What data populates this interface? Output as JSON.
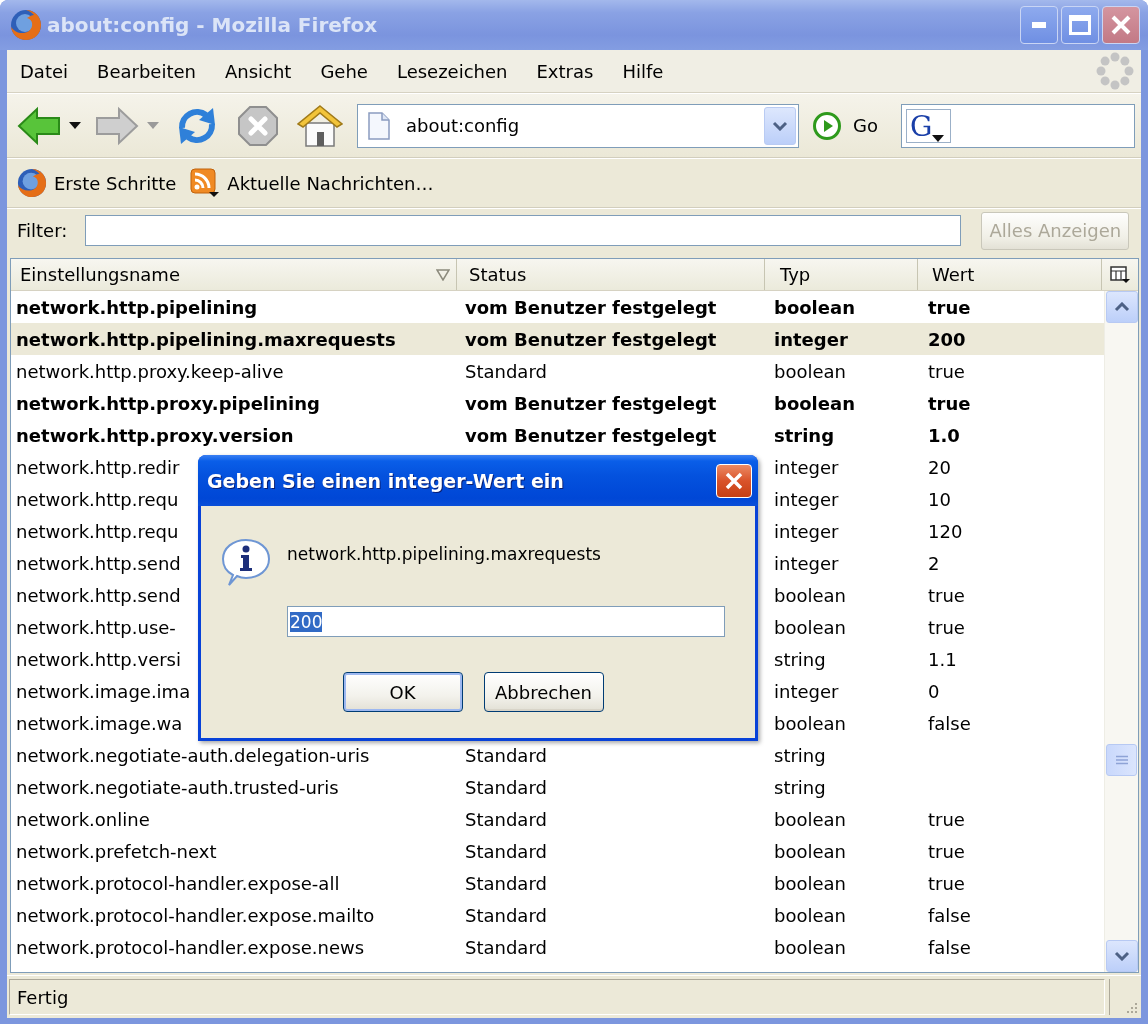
{
  "window": {
    "title": "about:config - Mozilla Firefox",
    "active": false
  },
  "menu": [
    {
      "label": "Datei"
    },
    {
      "label": "Bearbeiten"
    },
    {
      "label": "Ansicht"
    },
    {
      "label": "Gehe"
    },
    {
      "label": "Lesezeichen"
    },
    {
      "label": "Extras"
    },
    {
      "label": "Hilfe"
    }
  ],
  "navigation": {
    "buttons": [
      {
        "kind": "back",
        "disabled": false,
        "menu": true
      },
      {
        "kind": "forward",
        "disabled": true,
        "menu": true
      },
      {
        "kind": "reload",
        "disabled": false,
        "menu": false
      },
      {
        "kind": "stop",
        "disabled": true,
        "menu": false
      },
      {
        "kind": "home",
        "disabled": false,
        "menu": false
      }
    ],
    "url": "about:config",
    "go_label": "Go",
    "search_engine": "G"
  },
  "bookmarks": [
    {
      "kind": "page",
      "label": "Erste Schritte"
    },
    {
      "kind": "feed",
      "label": "Aktuelle Nachrichten…"
    }
  ],
  "filter": {
    "label": "Filter:",
    "button": {
      "label": "Alles Anzeigen",
      "disabled": true
    }
  },
  "table": {
    "columns": [
      {
        "label": "Einstellungsname",
        "sorted": true
      },
      {
        "label": "Status",
        "sorted": false
      },
      {
        "label": "Typ",
        "sorted": false
      },
      {
        "label": "Wert",
        "sorted": false
      }
    ],
    "rows": [
      {
        "name": "network.http.pipelining",
        "status": "vom Benutzer festgelegt",
        "type": "boolean",
        "value": "true",
        "modified": true,
        "selected": false
      },
      {
        "name": "network.http.pipelining.maxrequests",
        "status": "vom Benutzer festgelegt",
        "type": "integer",
        "value": "200",
        "modified": true,
        "selected": true
      },
      {
        "name": "network.http.proxy.keep-alive",
        "status": "Standard",
        "type": "boolean",
        "value": "true",
        "modified": false,
        "selected": false
      },
      {
        "name": "network.http.proxy.pipelining",
        "status": "vom Benutzer festgelegt",
        "type": "boolean",
        "value": "true",
        "modified": true,
        "selected": false
      },
      {
        "name": "network.http.proxy.version",
        "status": "vom Benutzer festgelegt",
        "type": "string",
        "value": "1.0",
        "modified": true,
        "selected": false
      },
      {
        "name": "network.http.redir",
        "type": "integer",
        "value": "20",
        "modified": false,
        "selected": false
      },
      {
        "name": "network.http.requ",
        "type": "integer",
        "value": "10",
        "modified": false,
        "selected": false
      },
      {
        "name": "network.http.requ",
        "type": "integer",
        "value": "120",
        "modified": false,
        "selected": false
      },
      {
        "name": "network.http.send",
        "type": "integer",
        "value": "2",
        "modified": false,
        "selected": false
      },
      {
        "name": "network.http.send",
        "type": "boolean",
        "value": "true",
        "modified": false,
        "selected": false
      },
      {
        "name": "network.http.use-",
        "type": "boolean",
        "value": "true",
        "modified": false,
        "selected": false
      },
      {
        "name": "network.http.versi",
        "type": "string",
        "value": "1.1",
        "modified": false,
        "selected": false
      },
      {
        "name": "network.image.ima",
        "type": "integer",
        "value": "0",
        "modified": false,
        "selected": false
      },
      {
        "name": "network.image.wa",
        "type": "boolean",
        "value": "false",
        "modified": false,
        "selected": false
      },
      {
        "name": "network.negotiate-auth.delegation-uris",
        "status": "Standard",
        "type": "string",
        "modified": false,
        "selected": false
      },
      {
        "name": "network.negotiate-auth.trusted-uris",
        "status": "Standard",
        "type": "string",
        "modified": false,
        "selected": false
      },
      {
        "name": "network.online",
        "status": "Standard",
        "type": "boolean",
        "value": "true",
        "modified": false,
        "selected": false
      },
      {
        "name": "network.prefetch-next",
        "status": "Standard",
        "type": "boolean",
        "value": "true",
        "modified": false,
        "selected": false
      },
      {
        "name": "network.protocol-handler.expose-all",
        "status": "Standard",
        "type": "boolean",
        "value": "true",
        "modified": false,
        "selected": false
      },
      {
        "name": "network.protocol-handler.expose.mailto",
        "status": "Standard",
        "type": "boolean",
        "value": "false",
        "modified": false,
        "selected": false
      },
      {
        "name": "network.protocol-handler.expose.news",
        "status": "Standard",
        "type": "boolean",
        "value": "false",
        "modified": false,
        "selected": false
      }
    ]
  },
  "dialog": {
    "title": "Geben Sie einen integer-Wert ein",
    "message": "network.http.pipelining.maxrequests",
    "value": "200",
    "value_selected": true,
    "buttons": [
      {
        "label": "OK",
        "default": true
      },
      {
        "label": "Abbrechen",
        "default": false
      }
    ]
  },
  "status_bar": {
    "text": "Fertig"
  }
}
